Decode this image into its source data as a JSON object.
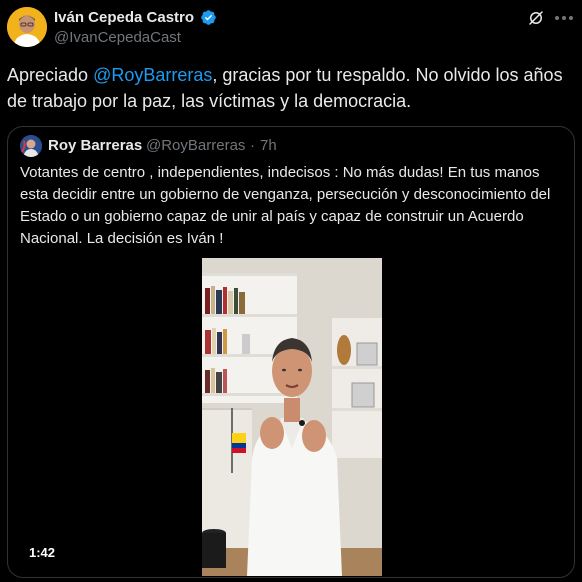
{
  "tweet": {
    "author": {
      "name": "Iván Cepeda Castro",
      "handle": "@IvanCepedaCast"
    },
    "icons": {
      "verified": "verified-badge-icon",
      "grok": "grok-icon",
      "more": "more-options-icon"
    },
    "text": {
      "prefix": "Apreciado ",
      "mention": "@RoyBarreras",
      "suffix": ", gracias por tu respaldo. No olvido los años de trabajo por la paz, las víctimas y la democracia."
    },
    "quote": {
      "name": "Roy Barreras",
      "handle": "@RoyBarreras",
      "separator": "·",
      "time": "7h",
      "text": "Votantes de centro , independientes, indecisos : No más dudas! En tus manos esta decidir entre un gobierno de venganza, persecución y desconocimiento del Estado o un gobierno capaz de unir al país y capaz de construir un Acuerdo Nacional. La decisión es Iván !",
      "video": {
        "duration": "1:42"
      }
    }
  },
  "colors": {
    "background": "#000000",
    "text": "#e7e9ea",
    "secondary": "#71767b",
    "accent": "#1d9bf0",
    "border": "#2f3336"
  }
}
